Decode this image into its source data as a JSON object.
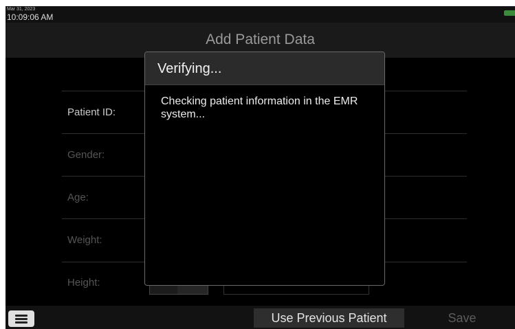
{
  "status": {
    "date": "Mar 31, 2023",
    "time": "10:09:06 AM",
    "battery_color": "#3c8a3c"
  },
  "title": "Add Patient Data",
  "form": {
    "fields": [
      {
        "label": "Patient ID:",
        "color": "#c9c9c9"
      },
      {
        "label": "Gender:",
        "color": "#555555"
      },
      {
        "label": "Age:",
        "color": "#555555"
      },
      {
        "label": "Weight:",
        "color": "#555555"
      },
      {
        "label": "Height:",
        "color": "#555555"
      }
    ]
  },
  "dialog": {
    "title": "Verifying...",
    "message": "Checking patient information in the EMR system..."
  },
  "bottom": {
    "menu_icon": "hamburger-menu-icon",
    "use_previous_label": "Use Previous Patient",
    "save_label": "Save"
  }
}
